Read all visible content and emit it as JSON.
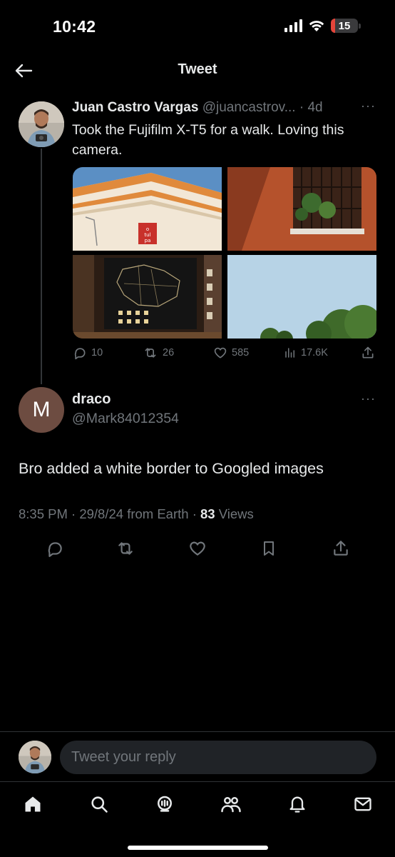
{
  "status_bar": {
    "time": "10:42",
    "battery_text": "15",
    "battery_level": 0.15,
    "icons": [
      "cellular-signal-icon",
      "wifi-icon",
      "battery-icon"
    ]
  },
  "header": {
    "title": "Tweet",
    "back_icon": "arrow-left-icon"
  },
  "quoted_tweet": {
    "author_name": "Juan Castro Vargas",
    "author_handle": "@juancastrov...",
    "separator": " · ",
    "time_ago": "4d",
    "more_icon": "ellipsis-icon",
    "more_text": "···",
    "text": "Took the Fujifilm X-T5 for a walk. Loving this camera.",
    "image_sign_text": [
      "o",
      "tul",
      "pa"
    ],
    "actions": {
      "replies": "10",
      "retweets": "26",
      "likes": "585",
      "views": "17.6K"
    }
  },
  "reply_tweet": {
    "avatar_letter": "M",
    "author_name": "draco",
    "author_handle": "@Mark84012354",
    "more_text": "···",
    "text": "Bro added a white border to Googled images",
    "meta_prefix": "8:35 PM · 29/8/24 from Earth · ",
    "views_count": "83",
    "views_label": " Views"
  },
  "reply_bar": {
    "placeholder": "Tweet your reply"
  },
  "bottom_nav": {
    "items": [
      "home-icon",
      "search-icon",
      "spaces-icon",
      "communities-icon",
      "notifications-icon",
      "messages-icon"
    ]
  },
  "colors": {
    "background": "#000000",
    "text_primary": "#e7e9ea",
    "text_secondary": "#71767b",
    "battery_low": "#e5453a",
    "reply_avatar_bg": "#6d4c41"
  }
}
